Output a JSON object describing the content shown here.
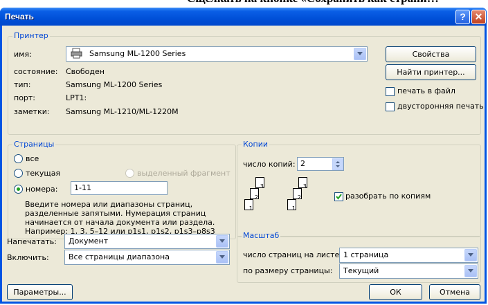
{
  "background": {
    "text": "Сщелкать  на кнопке «Сохранить как страни…"
  },
  "window": {
    "title": "Печать",
    "help_glyph": "?",
    "close_glyph": "✕"
  },
  "printer": {
    "legend": "Принтер",
    "name_label": "имя:",
    "name_value": "Samsung ML-1200 Series",
    "status_label": "состояние:",
    "status_value": "Свободен",
    "type_label": "тип:",
    "type_value": "Samsung ML-1200 Series",
    "port_label": "порт:",
    "port_value": "LPT1:",
    "notes_label": "заметки:",
    "notes_value": "Samsung ML-1210/ML-1220M",
    "properties_button": "Свойства",
    "find_printer_button": "Найти принтер...",
    "print_to_file_label": "печать в файл",
    "duplex_label": "двусторонняя печать"
  },
  "pages": {
    "legend": "Страницы",
    "all_label": "все",
    "current_label": "текущая",
    "selection_label": "выделенный фрагмент",
    "numbers_label": "номера:",
    "numbers_value": "1-11",
    "help_lines": [
      "Введите номера или диапазоны страниц,",
      "разделенные запятыми. Нумерация страниц",
      "начинается от начала документа или раздела.",
      "Например: 1, 3, 5–12 или p1s1, p1s2, p1s3–p8s3"
    ]
  },
  "copies": {
    "legend": "Копии",
    "count_label": "число копий:",
    "count_value": "2",
    "collate_label": "разобрать по копиям",
    "collate_checked": true,
    "sheet_numbers": [
      "1",
      "2",
      "3"
    ]
  },
  "print_what": {
    "label": "Напечатать:",
    "value": "Документ"
  },
  "include": {
    "label": "Включить:",
    "value": "Все страницы диапазона"
  },
  "zoom": {
    "legend": "Масштаб",
    "pages_per_sheet_label": "число страниц на листе:",
    "pages_per_sheet_value": "1 страница",
    "scale_label": "по размеру страницы:",
    "scale_value": "Текущий"
  },
  "buttons": {
    "options": "Параметры...",
    "ok": "ОК",
    "cancel": "Отмена"
  },
  "colors": {
    "title_bar": "#0054e3",
    "dialog_face": "#ece9d8",
    "group_legend": "#0046d5",
    "radio_dot": "#21a121"
  }
}
